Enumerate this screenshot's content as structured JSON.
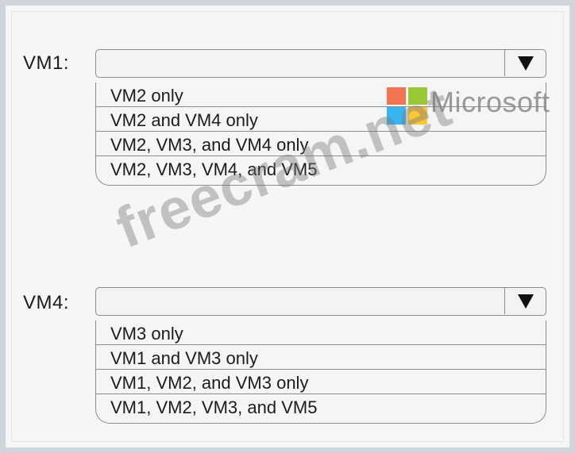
{
  "questions": [
    {
      "label": "VM1:",
      "options": [
        "VM2 only",
        "VM2 and VM4 only",
        "VM2, VM3, and VM4 only",
        "VM2, VM3, VM4, and VM5"
      ]
    },
    {
      "label": "VM4:",
      "options": [
        "VM3 only",
        "VM1 and VM3 only",
        "VM1, VM2, and VM3 only",
        "VM1, VM2, VM3, and VM5"
      ]
    }
  ],
  "branding": {
    "logo_text": "Microsoft",
    "watermark": "freecram.net",
    "logo_colors": [
      "#f25022",
      "#7fba00",
      "#00a4ef",
      "#ffb900"
    ]
  }
}
